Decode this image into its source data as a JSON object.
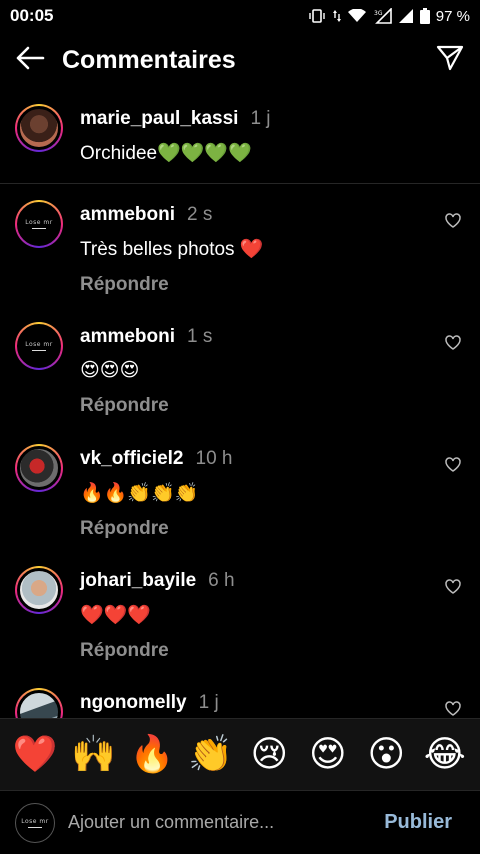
{
  "status": {
    "time": "00:05",
    "battery": "97 %",
    "network": "3G"
  },
  "header": {
    "title": "Commentaires"
  },
  "caption": {
    "username": "marie_paul_kassi",
    "time": "1 j",
    "text": "Orchidee💚💚💚💚"
  },
  "comments": [
    {
      "username": "ammeboni",
      "time": "2 s",
      "text": "Très belles photos ❤️",
      "reply": "Répondre",
      "avatar_text": "Lose mr"
    },
    {
      "username": "ammeboni",
      "time": "1 s",
      "text": "😍😍😍",
      "reply": "Répondre",
      "avatar_text": "Lose mr"
    },
    {
      "username": "vk_officiel2",
      "time": "10 h",
      "text": "🔥🔥👏👏👏",
      "reply": "Répondre"
    },
    {
      "username": "johari_bayile",
      "time": "6 h",
      "text": "❤️❤️❤️",
      "reply": "Répondre"
    },
    {
      "username": "ngonomelly",
      "time": "1 j"
    }
  ],
  "emoji_bar": [
    "❤️",
    "🙌",
    "🔥",
    "👏",
    "😢",
    "😍",
    "😮",
    "😂"
  ],
  "compose": {
    "placeholder": "Ajouter un commentaire...",
    "publish_label": "Publier",
    "avatar_text": "Lose mr"
  },
  "colors": {
    "background": "#000000",
    "muted": "#8e8e8e",
    "publish": "#b3dbff",
    "divider": "#262626"
  }
}
